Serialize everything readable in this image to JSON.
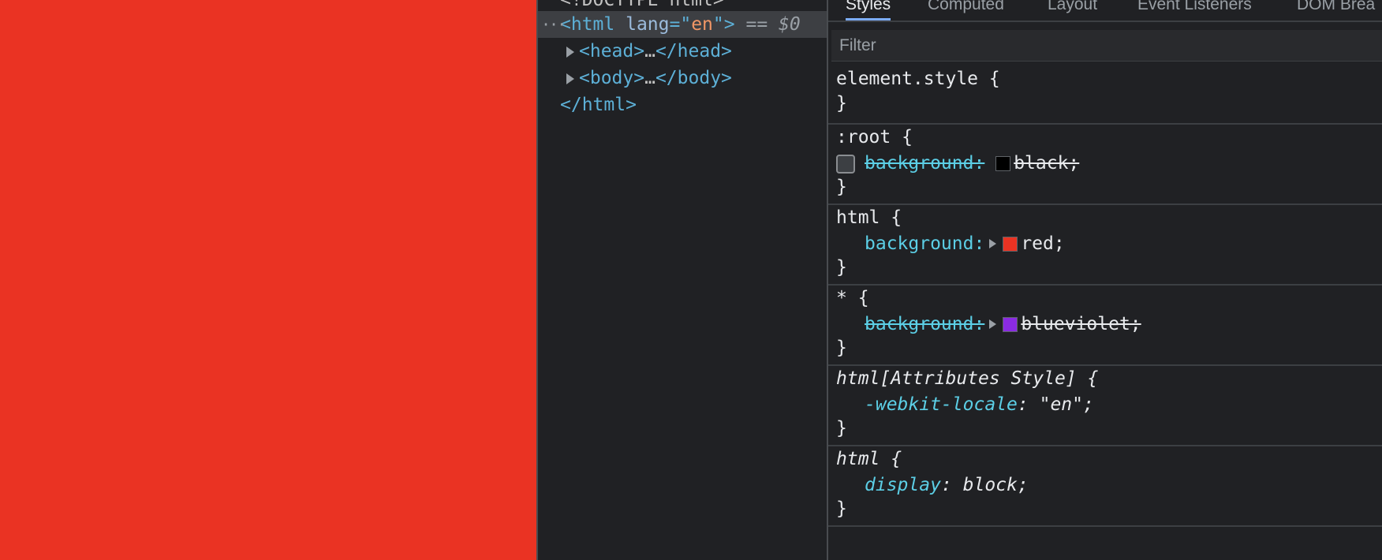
{
  "viewport": {
    "background_color": "#ea3323"
  },
  "elements": {
    "lines": [
      {
        "text": "<!DOCTYPE html>"
      },
      {
        "open_lt": "<",
        "tag": "html",
        "attr_name": "lang",
        "eq": "=\"",
        "attr_value": "en",
        "close": "\">",
        "marker": "== $0",
        "dots": "···"
      },
      {
        "open": "<head>",
        "ellipsis": "…",
        "close": "</head>"
      },
      {
        "open": "<body>",
        "ellipsis": "…",
        "close": "</body>"
      },
      {
        "text": "</html>"
      }
    ]
  },
  "styles": {
    "tabs": [
      "Styles",
      "Computed",
      "Layout",
      "Event Listeners",
      "DOM Brea"
    ],
    "filter_placeholder": "Filter",
    "rules": [
      {
        "selector": "element.style {",
        "close": "}"
      },
      {
        "selector": ":root {",
        "prop_name": "background:",
        "swatch": "#000000",
        "prop_value": "black;",
        "close": "}"
      },
      {
        "selector": "html {",
        "prop_name": "background:",
        "swatch": "#ea3323",
        "prop_value": "red;",
        "close": "}"
      },
      {
        "selector": "* {",
        "prop_name": "background:",
        "swatch": "#8a2be2",
        "prop_value": "blueviolet;",
        "close": "}"
      },
      {
        "selector": "html[Attributes Style] {",
        "prop_name": "-webkit-locale",
        "colon": ":",
        "prop_value": "\"en\";",
        "close": "}"
      },
      {
        "selector": "html {",
        "prop_name": "display",
        "colon": ":",
        "prop_value": "block;",
        "close": "}"
      }
    ]
  }
}
